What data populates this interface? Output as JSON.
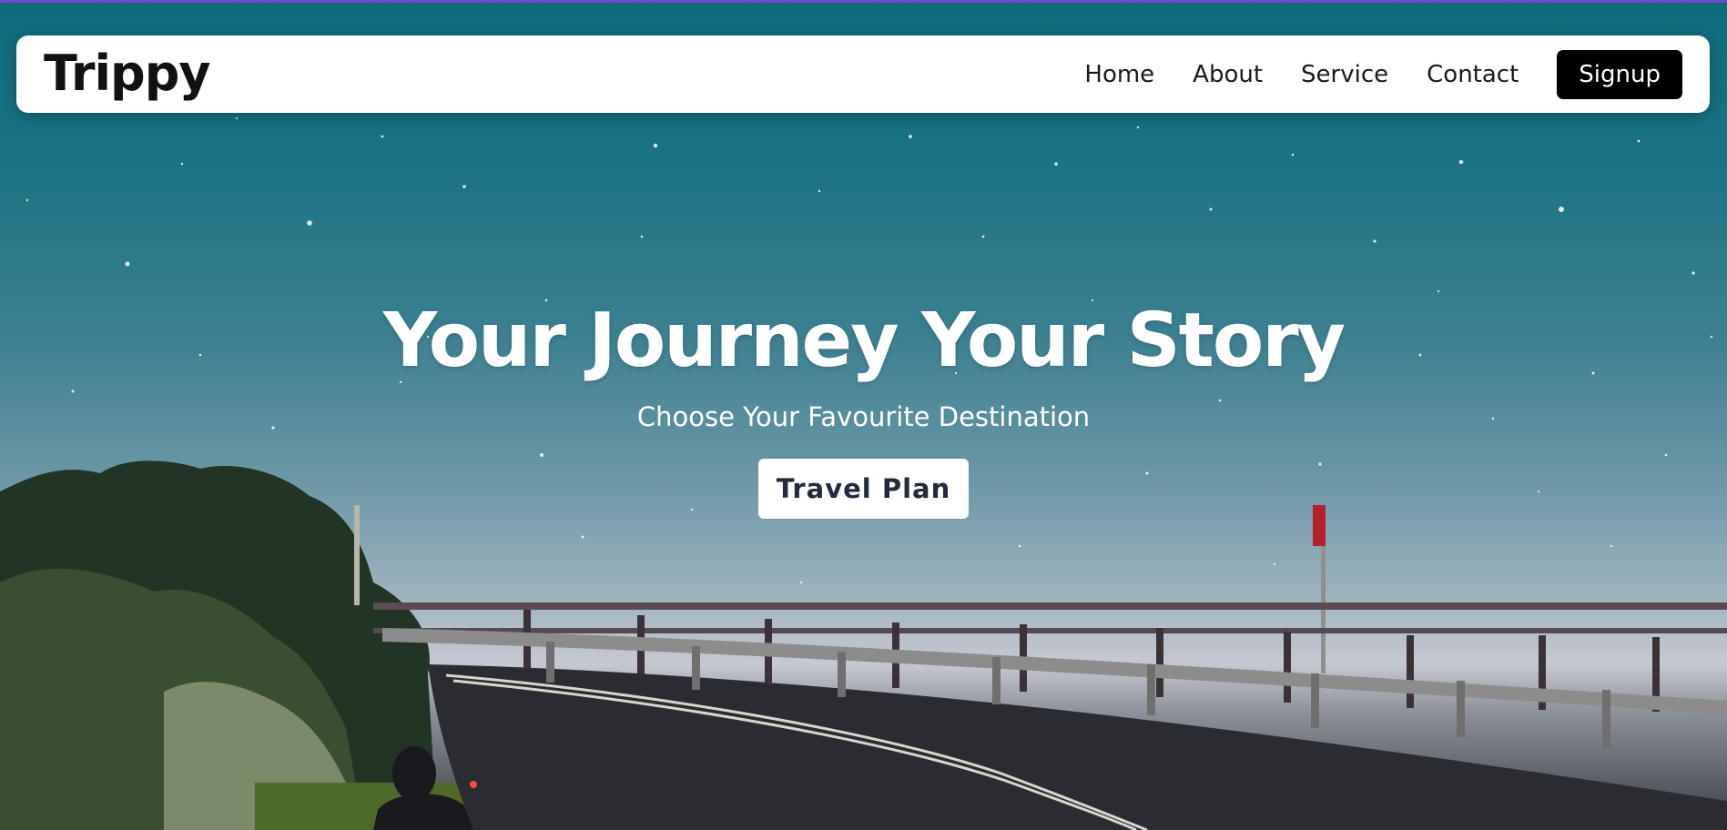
{
  "brand": {
    "name": "Trippy"
  },
  "nav": {
    "links": [
      "Home",
      "About",
      "Service",
      "Contact"
    ],
    "signup_label": "Signup"
  },
  "hero": {
    "title": "Your Journey Your Story",
    "subtitle": "Choose Your Favourite Destination",
    "cta_label": "Travel Plan"
  },
  "colors": {
    "accent_top_line": "#6a4cc8",
    "navbar_bg": "#ffffff",
    "signup_bg": "#000000",
    "cta_text": "#222a3c",
    "sky_top": "#0e6a7a"
  },
  "background": {
    "icon": "night-sky-road-photo-icon"
  }
}
